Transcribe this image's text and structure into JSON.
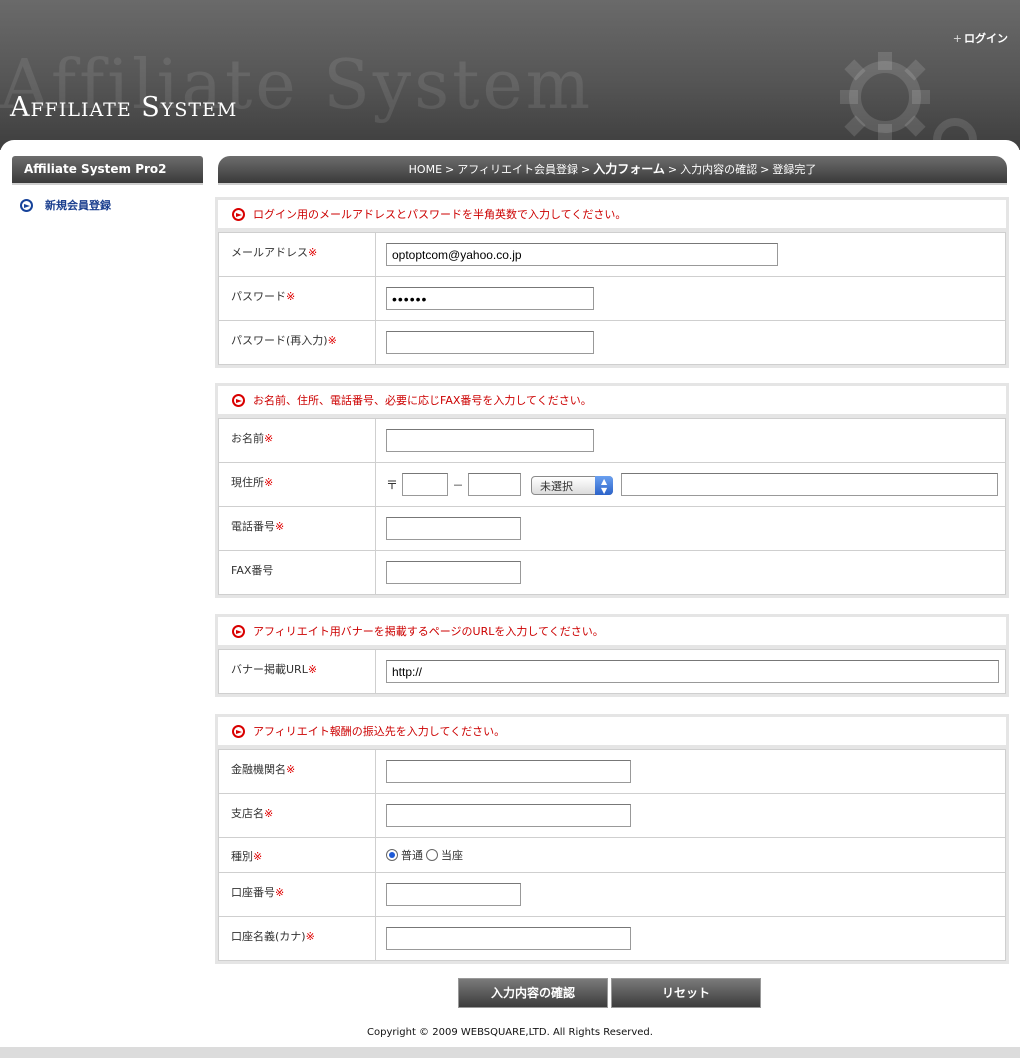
{
  "header": {
    "logo": "Affiliate System",
    "watermark": "Affiliate System",
    "login_link": "ログイン"
  },
  "sidebar": {
    "title": "Affiliate System Pro2",
    "items": [
      {
        "label": "新規会員登録"
      }
    ]
  },
  "breadcrumb": {
    "items": [
      "HOME",
      "アフィリエイト会員登録",
      "入力フォーム",
      "入力内容の確認",
      "登録完了"
    ],
    "current_index": 2
  },
  "sections": {
    "login": {
      "heading": "ログイン用のメールアドレスとパスワードを半角英数で入力してください。",
      "email_label": "メールアドレス",
      "email_value": "optoptcom@yahoo.co.jp",
      "password_label": "パスワード",
      "password_value": "••••••",
      "password_confirm_label": "パスワード(再入力)"
    },
    "contact": {
      "heading": "お名前、住所、電話番号、必要に応じFAX番号を入力してください。",
      "name_label": "お名前",
      "address_label": "現住所",
      "zip_mark": "〒",
      "zip_dash": "－",
      "prefecture_selected": "未選択",
      "tel_label": "電話番号",
      "fax_label": "FAX番号"
    },
    "banner": {
      "heading": "アフィリエイト用バナーを掲載するページのURLを入力してください。",
      "url_label": "バナー掲載URL",
      "url_value": "http://"
    },
    "bank": {
      "heading": "アフィリエイト報酬の振込先を入力してください。",
      "bank_label": "金融機関名",
      "branch_label": "支店名",
      "type_label": "種別",
      "type_options": [
        "普通",
        "当座"
      ],
      "type_selected": "普通",
      "account_number_label": "口座番号",
      "account_name_label": "口座名義(カナ)"
    }
  },
  "required_mark": "※",
  "buttons": {
    "confirm": "入力内容の確認",
    "reset": "リセット"
  },
  "footer": {
    "copyright": "Copyright © 2009 WEBSQUARE,LTD. All Rights Reserved."
  },
  "colors": {
    "accent_red": "#cc0000",
    "link_blue": "#1b3f8f",
    "header_dark": "#3e3e3e"
  }
}
